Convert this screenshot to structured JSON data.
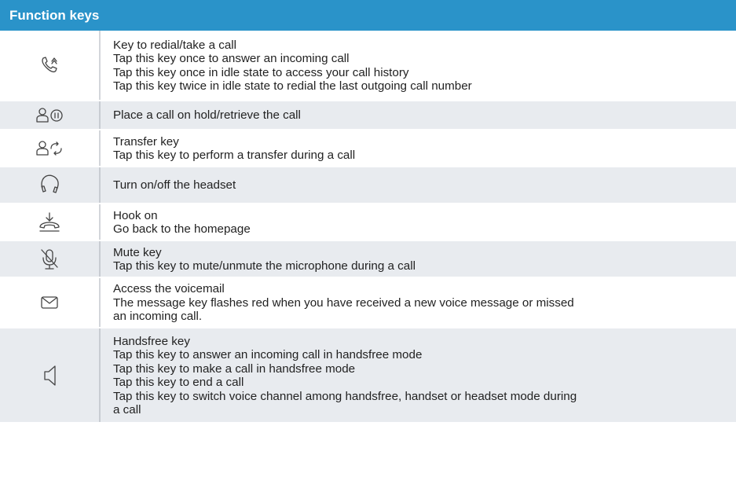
{
  "header": {
    "title": "Function keys"
  },
  "rows": [
    {
      "icon": "redial-call-icon",
      "lines": [
        "Key to redial/take a call",
        "Tap this key once to answer an incoming call",
        "Tap this key once in idle state to access your call history",
        "Tap this key twice in idle state to redial the last outgoing call number"
      ]
    },
    {
      "icon": "hold-icon",
      "lines": [
        "Place a call on hold/retrieve the call"
      ]
    },
    {
      "icon": "transfer-icon",
      "lines": [
        "Transfer key",
        "Tap this key to perform a transfer during a call"
      ]
    },
    {
      "icon": "headset-icon",
      "lines": [
        "Turn on/off the headset"
      ]
    },
    {
      "icon": "hook-on-icon",
      "lines": [
        "Hook on",
        "Go back to the homepage"
      ]
    },
    {
      "icon": "mute-icon",
      "lines": [
        "Mute key",
        "Tap this key to mute/unmute the microphone during a call"
      ]
    },
    {
      "icon": "voicemail-icon",
      "lines": [
        "Access the voicemail",
        "The message key flashes red when you have received a new voice message or missed",
        "an incoming call."
      ]
    },
    {
      "icon": "handsfree-icon",
      "lines": [
        "Handsfree key",
        "Tap this key to answer an incoming call in handsfree mode",
        "Tap this key to make a call in handsfree mode",
        "Tap this key to end a call",
        "Tap this key to switch voice channel among handsfree, handset or headset mode during",
        "a call"
      ]
    }
  ],
  "colors": {
    "header_bg": "#2a93c9",
    "row_shade": "#e8ebef"
  }
}
